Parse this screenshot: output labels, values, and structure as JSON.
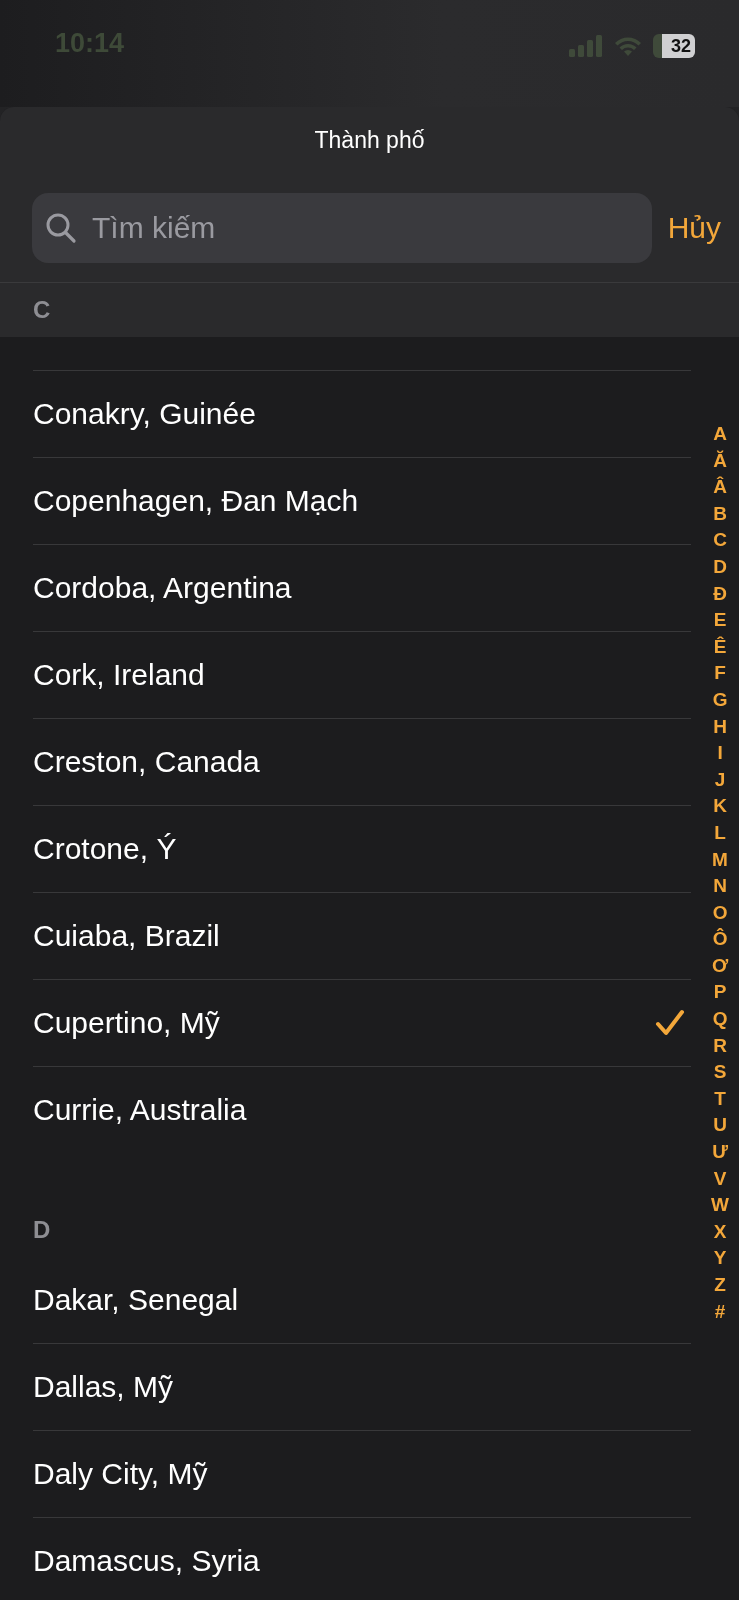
{
  "status_bar": {
    "time": "10:14",
    "battery": "32"
  },
  "sheet": {
    "title": "Thành phố",
    "search": {
      "placeholder": "Tìm kiếm"
    },
    "cancel": "Hủy"
  },
  "sections": [
    {
      "letter": "C",
      "rows": [
        {
          "name": "Conakry, Guinée",
          "selected": false
        },
        {
          "name": "Copenhagen, Đan Mạch",
          "selected": false
        },
        {
          "name": "Cordoba, Argentina",
          "selected": false
        },
        {
          "name": "Cork, Ireland",
          "selected": false
        },
        {
          "name": "Creston, Canada",
          "selected": false
        },
        {
          "name": "Crotone, Ý",
          "selected": false
        },
        {
          "name": "Cuiaba, Brazil",
          "selected": false
        },
        {
          "name": "Cupertino, Mỹ",
          "selected": true
        },
        {
          "name": "Currie, Australia",
          "selected": false
        }
      ]
    },
    {
      "letter": "D",
      "rows": [
        {
          "name": "Dakar, Senegal",
          "selected": false
        },
        {
          "name": "Dallas, Mỹ",
          "selected": false
        },
        {
          "name": "Daly City, Mỹ",
          "selected": false
        },
        {
          "name": "Damascus, Syria",
          "selected": false
        }
      ]
    }
  ],
  "index": [
    "A",
    "Ă",
    "Â",
    "B",
    "C",
    "D",
    "Đ",
    "E",
    "Ê",
    "F",
    "G",
    "H",
    "I",
    "J",
    "K",
    "L",
    "M",
    "N",
    "O",
    "Ô",
    "Ơ",
    "P",
    "Q",
    "R",
    "S",
    "T",
    "U",
    "Ư",
    "V",
    "W",
    "X",
    "Y",
    "Z",
    "#"
  ]
}
